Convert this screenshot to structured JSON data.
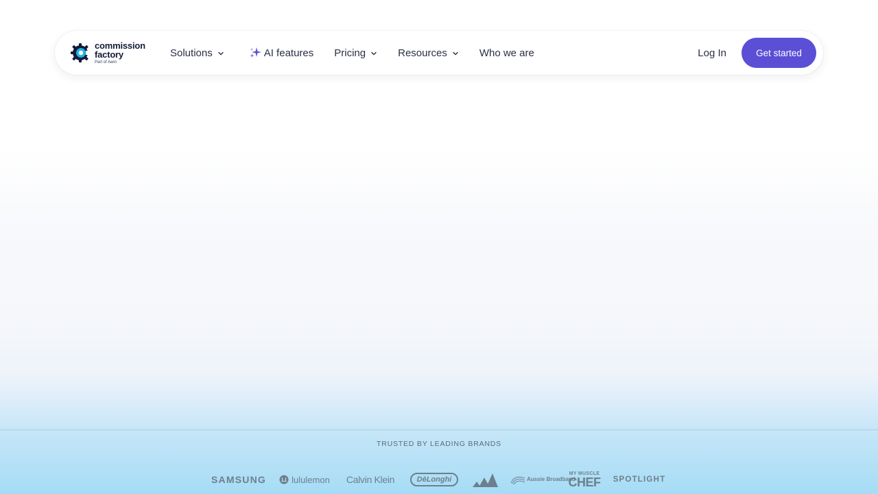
{
  "brand": {
    "logo_line1": "commission",
    "logo_line2": "factory",
    "logo_sub": "Part of Awin",
    "accent_color": "#5b4fd6",
    "logo_ring_color": "#1bb3e6"
  },
  "nav": {
    "items": [
      {
        "label": "Solutions",
        "has_dropdown": true
      },
      {
        "label": "AI features",
        "icon": "sparkle-icon"
      },
      {
        "label": "Pricing",
        "has_dropdown": true
      },
      {
        "label": "Resources",
        "has_dropdown": true
      },
      {
        "label": "Who we are"
      }
    ],
    "login_label": "Log In",
    "cta_label": "Get started"
  },
  "trusted": {
    "label": "TRUSTED BY LEADING BRANDS",
    "brands": [
      {
        "name": "SAMSUNG"
      },
      {
        "name": "lululemon"
      },
      {
        "name": "Calvin Klein"
      },
      {
        "name": "DēLonghi"
      },
      {
        "name": "adidas"
      },
      {
        "name": "Aussie Broadband"
      },
      {
        "name_top": "MY MUSCLE",
        "name_bottom": "CHEF"
      },
      {
        "name": "SPOTLIGHT"
      }
    ]
  }
}
